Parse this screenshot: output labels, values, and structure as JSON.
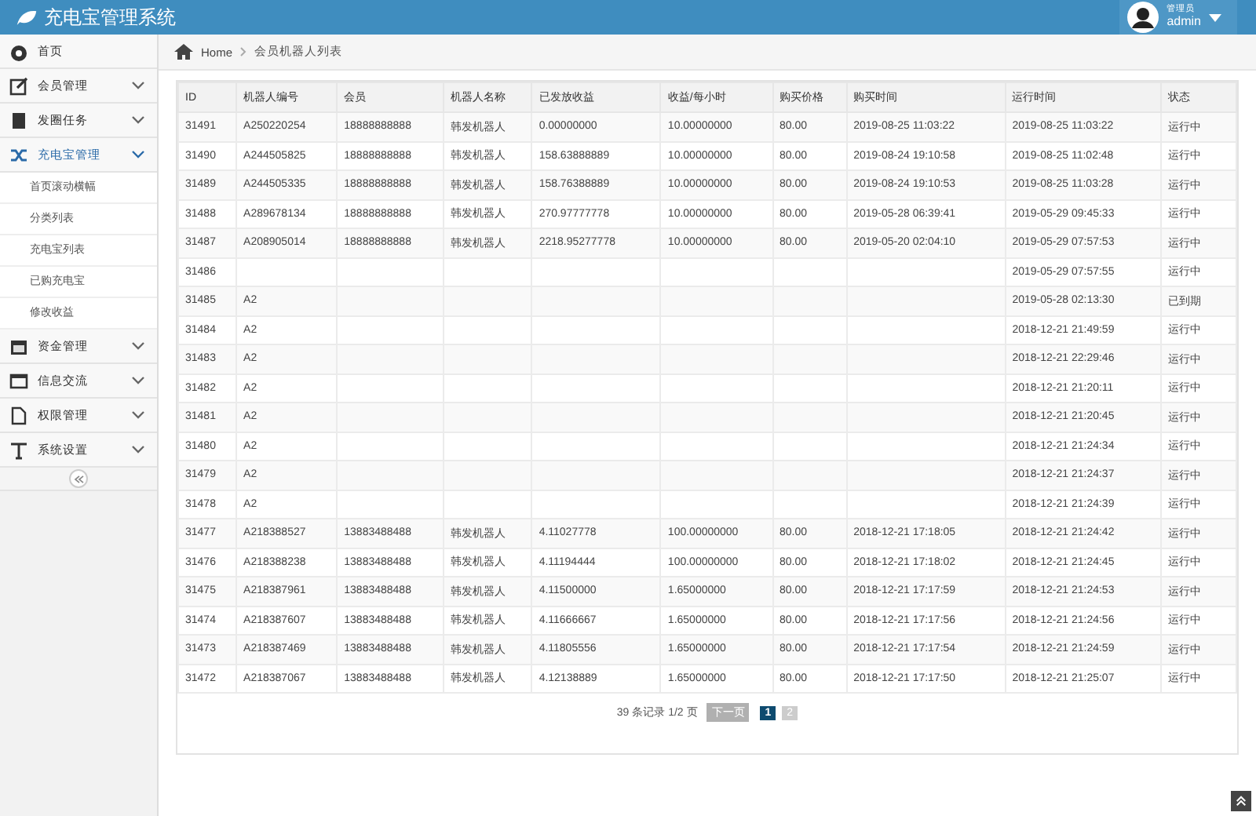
{
  "header": {
    "title": "充电宝管理系统",
    "user_role": "管理员",
    "user_name": "admin"
  },
  "sidebar": {
    "items": [
      {
        "label": "首页",
        "selected": false
      },
      {
        "label": "会员管理",
        "selected": false
      },
      {
        "label": "发圈任务",
        "selected": false
      },
      {
        "label": "充电宝管理",
        "selected": true,
        "expanded": true,
        "children": [
          {
            "label": "首页滚动横幅",
            "selected": false
          },
          {
            "label": "分类列表",
            "selected": false
          },
          {
            "label": "充电宝列表",
            "selected": false
          },
          {
            "label": "已购充电宝",
            "selected": false
          },
          {
            "label": "修改收益",
            "selected": false
          }
        ]
      },
      {
        "label": "资金管理",
        "selected": false
      },
      {
        "label": "信息交流",
        "selected": false
      },
      {
        "label": "权限管理",
        "selected": false
      },
      {
        "label": "系统设置",
        "selected": false
      }
    ]
  },
  "breadcrumb": [
    "Home",
    "会员机器人列表"
  ],
  "table": {
    "columns": [
      "ID",
      "机器人编号",
      "会员",
      "机器人名称",
      "已发放收益",
      "收益/每小时",
      "购买价格",
      "购买时间",
      "运行时间",
      "状态"
    ],
    "rows": [
      [
        "31491",
        "A250220254",
        "18888888888",
        "韩发机器人",
        "0.00000000",
        "10.00000000",
        "80.00",
        "2019-08-25 11:03:22",
        "2019-08-25 11:03:22",
        "运行中"
      ],
      [
        "31490",
        "A244505825",
        "18888888888",
        "韩发机器人",
        "158.63888889",
        "10.00000000",
        "80.00",
        "2019-08-24 19:10:58",
        "2019-08-25 11:02:48",
        "运行中"
      ],
      [
        "31489",
        "A244505335",
        "18888888888",
        "韩发机器人",
        "158.76388889",
        "10.00000000",
        "80.00",
        "2019-08-24 19:10:53",
        "2019-08-25 11:03:28",
        "运行中"
      ],
      [
        "31488",
        "A289678134",
        "18888888888",
        "韩发机器人",
        "270.97777778",
        "10.00000000",
        "80.00",
        "2019-05-28 06:39:41",
        "2019-05-29 09:45:33",
        "运行中"
      ],
      [
        "31487",
        "A208905014",
        "18888888888",
        "韩发机器人",
        "2218.95277778",
        "10.00000000",
        "80.00",
        "2019-05-20 02:04:10",
        "2019-05-29 07:57:53",
        "运行中"
      ],
      [
        "31486",
        null,
        null,
        null,
        null,
        null,
        null,
        null,
        "2019-05-29 07:57:55",
        "运行中"
      ],
      [
        "31485",
        "A2",
        null,
        null,
        null,
        null,
        null,
        null,
        "2019-05-28 02:13:30",
        "已到期"
      ],
      [
        "31484",
        "A2",
        null,
        null,
        null,
        null,
        null,
        null,
        "2018-12-21 21:49:59",
        "运行中"
      ],
      [
        "31483",
        "A2",
        null,
        null,
        null,
        null,
        null,
        null,
        "2018-12-21 22:29:46",
        "运行中"
      ],
      [
        "31482",
        "A2",
        null,
        null,
        null,
        null,
        null,
        null,
        "2018-12-21 21:20:11",
        "运行中"
      ],
      [
        "31481",
        "A2",
        null,
        null,
        null,
        null,
        null,
        null,
        "2018-12-21 21:20:45",
        "运行中"
      ],
      [
        "31480",
        "A2",
        null,
        null,
        null,
        null,
        null,
        null,
        "2018-12-21 21:24:34",
        "运行中"
      ],
      [
        "31479",
        "A2",
        null,
        null,
        null,
        null,
        null,
        null,
        "2018-12-21 21:24:37",
        "运行中"
      ],
      [
        "31478",
        "A2",
        null,
        null,
        null,
        null,
        null,
        null,
        "2018-12-21 21:24:39",
        "运行中"
      ],
      [
        "31477",
        "A218388527",
        "13883488488",
        "韩发机器人",
        "4.11027778",
        "100.00000000",
        "80.00",
        "2018-12-21 17:18:05",
        "2018-12-21 21:24:42",
        "运行中"
      ],
      [
        "31476",
        "A218388238",
        "13883488488",
        "韩发机器人",
        "4.11194444",
        "100.00000000",
        "80.00",
        "2018-12-21 17:18:02",
        "2018-12-21 21:24:45",
        "运行中"
      ],
      [
        "31475",
        "A218387961",
        "13883488488",
        "韩发机器人",
        "4.11500000",
        "1.65000000",
        "80.00",
        "2018-12-21 17:17:59",
        "2018-12-21 21:24:53",
        "运行中"
      ],
      [
        "31474",
        "A218387607",
        "13883488488",
        "韩发机器人",
        "4.11666667",
        "1.65000000",
        "80.00",
        "2018-12-21 17:17:56",
        "2018-12-21 21:24:56",
        "运行中"
      ],
      [
        "31473",
        "A218387469",
        "13883488488",
        "韩发机器人",
        "4.11805556",
        "1.65000000",
        "80.00",
        "2018-12-21 17:17:54",
        "2018-12-21 21:24:59",
        "运行中"
      ],
      [
        "31472",
        "A218387067",
        "13883488488",
        "韩发机器人",
        "4.12138889",
        "1.65000000",
        "80.00",
        "2018-12-21 17:17:50",
        "2018-12-21 21:25:07",
        "运行中"
      ]
    ]
  },
  "pagination": {
    "summary": "39 条记录 1/2 页",
    "next": {
      "label": "下一页",
      "disabled": true
    },
    "pages": [
      {
        "label": "1",
        "selected": true
      },
      {
        "label": "2",
        "selected": false
      }
    ]
  }
}
